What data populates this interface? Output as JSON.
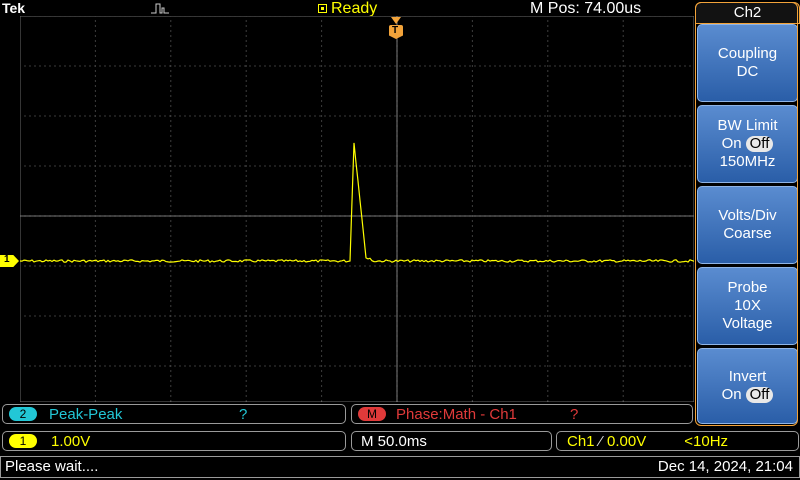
{
  "top": {
    "brand": "Tek",
    "acq_status": "Ready",
    "horizontal_position": "M Pos: 74.00us"
  },
  "waveform": {
    "channel_marker": "1",
    "color": "#ffff00",
    "trigger_marker": "T"
  },
  "menu": {
    "title": "Ch2",
    "buttons": [
      {
        "line1": "Coupling",
        "line2": "DC"
      },
      {
        "line1": "BW Limit",
        "line2_prefix": "On",
        "line2_pill": "Off",
        "line3": "150MHz"
      },
      {
        "line1": "Volts/Div",
        "line2": "Coarse"
      },
      {
        "line1": "Probe",
        "line2": "10X",
        "line3": "Voltage"
      },
      {
        "line1": "Invert",
        "line2_prefix": "On",
        "line2_pill": "Off"
      }
    ]
  },
  "measurements": {
    "m1": {
      "badge": "2",
      "label": "Peak-Peak",
      "value": "?"
    },
    "m2": {
      "badge": "M",
      "label": "Phase:Math - Ch1",
      "value": "?"
    }
  },
  "settings": {
    "ch1_badge": "1",
    "ch1_scale": "1.00V",
    "timebase": "M 50.0ms",
    "trigger_source": "Ch1",
    "trigger_slope_symbol": "⁄",
    "trigger_level": "0.00V",
    "trigger_freq": "<10Hz"
  },
  "status_bar": {
    "message": "Please wait....",
    "datetime": "Dec 14, 2024, 21:04"
  },
  "colors": {
    "ch1": "#ffff00",
    "ch2": "#22c7d6",
    "math": "#e03a3a",
    "trigger": "#f2a33a",
    "menu_button": "#3f74be"
  }
}
